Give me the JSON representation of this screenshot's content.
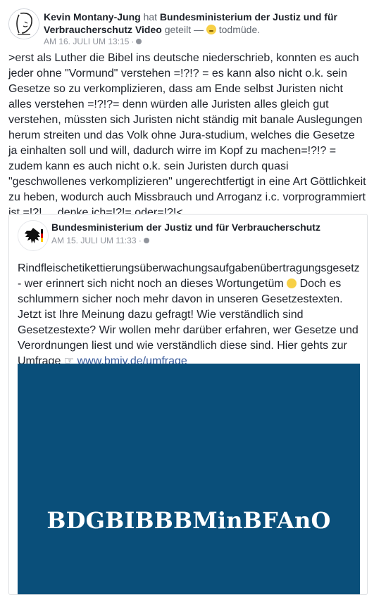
{
  "post": {
    "author": "Kevin Montany-Jung",
    "verb": "hat",
    "shared_page": "Bundesministerium der Justiz und für Verbraucherschutz",
    "shared_object": "Video",
    "action": "geteilt",
    "feeling_dash": "—",
    "feeling_label": "todmüde.",
    "date": "AM 16. JULI UM 13:15",
    "meta_dot": "·",
    "text": ">erst als Luther die Bibel ins deutsche niederschrieb, konnten es auch jeder ohne \"Vormund\" verstehen =!?!? = es kann also nicht o.k. sein Gesetze so zu verkomplizieren, dass am Ende selbst Juristen nicht alles verstehen =!?!?= denn würden alle Juristen alles gleich gut verstehen, müssten sich Juristen nicht ständig mit banale Auslegungen herum streiten und das Volk ohne Jura-studium, welches die Gesetze ja einhalten soll und will, dadurch wirre im Kopf zu machen=!?!? = zudem kann es auch nicht o.k. sein Juristen durch quasi \"geschwollenes verkomplizieren\" ungerechtfertigt in eine Art Göttlichkeit zu heben, wodurch auch Missbrauch und Arroganz i.c. vorprogrammiert ist =!?! ... denke ich=!?!= oder=!?!<"
  },
  "shared": {
    "page_name": "Bundesministerium der Justiz und für Verbraucherschutz",
    "date": "AM 15. JULI UM 11:33",
    "meta_dot": "·",
    "text_part1": "Rindfleischetikettierungsüberwachungsaufgabenübertragungsgesetz - wer erinnert sich nicht noch an dieses Wortungetüm",
    "text_part2": "Doch es schlummern sicher noch mehr davon in unseren Gesetzestexten. Jetzt ist Ihre Meinung dazu gefragt! Wie verständlich sind Gesetzestexte? Wir wollen mehr darüber erfahren, wer Gesetze und Verordnungen liest und wie verständlich diese sind. Hier gehts zur Umfrage",
    "link_text": "www.bmjv.de/umfrage",
    "image_text": "BDGBIBBBMinBFAnO"
  },
  "icons": {
    "author_avatar": "sketch-face-avatar",
    "page_avatar": "federal-eagle-logo",
    "feeling": "sleepy-face-emoji",
    "smile": "smiling-face-emoji",
    "pointer": "pointing-hand-icon",
    "privacy": "globe-icon"
  },
  "colors": {
    "link": "#365899",
    "meta": "#90949c",
    "image_bg": "#0a4f7a"
  }
}
